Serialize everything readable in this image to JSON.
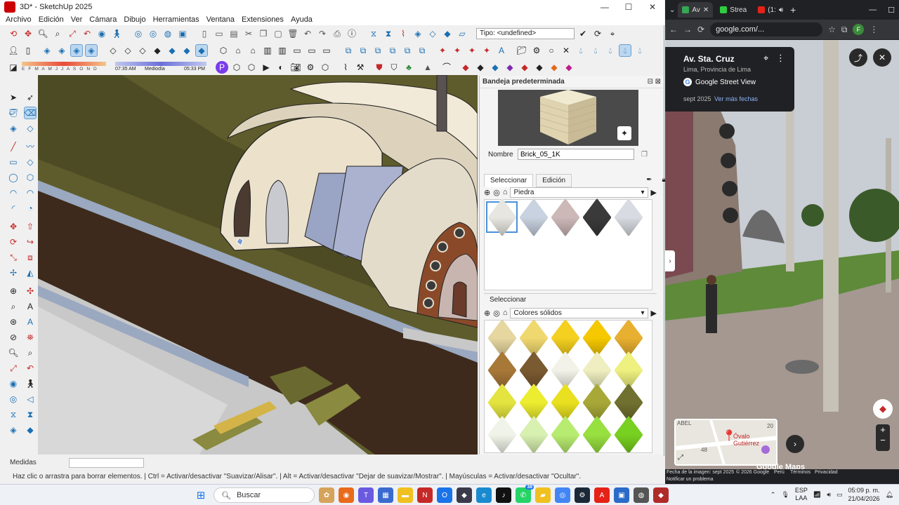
{
  "sketchup": {
    "title": "3D* - SketchUp 2025",
    "menu": [
      "Archivo",
      "Edición",
      "Ver",
      "Cámara",
      "Dibujo",
      "Herramientas",
      "Ventana",
      "Extensiones",
      "Ayuda"
    ],
    "tipo_field": "Tipo: <undefined>",
    "shadow_months": "E F M A M J J A S O N D",
    "time_start": "07:35 AM",
    "time_mid": "Mediodía",
    "time_end": "05:33 PM",
    "tray_title": "Bandeja predeterminada",
    "nombre_label": "Nombre",
    "material_name": "Brick_05_1K",
    "tab_select": "Seleccionar",
    "tab_edit": "Edición",
    "collection1": "Piedra",
    "select2_label": "Seleccionar",
    "collection2": "Colores sólidos",
    "medidas_label": "Medidas",
    "status_hint": "Haz clic o arrastra para borrar elementos. | Ctrl = Activar/desactivar \"Suavizar/Alisar\". | Alt = Activar/desactivar \"Dejar de suavizar/Mostrar\". | Mayúsculas = Activar/desactivar \"Ocultar\".",
    "stone_colors": [
      "#e8e6e0",
      "#c8d2e0",
      "#cdb8b8",
      "#3a3a3a",
      "#d8dce2"
    ],
    "solid_colors": [
      "#e6d6a0",
      "#f0d870",
      "#f4d020",
      "#f5c800",
      "#e8b030",
      "#a87838",
      "#7a5a30",
      "#f2f2e8",
      "#eeeec0",
      "#eef080",
      "#e4e440",
      "#ecec30",
      "#e8e020",
      "#a8a838",
      "#707030",
      "#f0f4e8",
      "#d8f0b0",
      "#b8ec70",
      "#98e040",
      "#78d020"
    ]
  },
  "chrome": {
    "tabs": [
      {
        "label": "Av",
        "color": "#34a853"
      },
      {
        "label": "Strea",
        "color": "#2ecc40"
      },
      {
        "label": "(1:",
        "color": "#e62117"
      }
    ],
    "url": "google.com/...",
    "place": "Av. Sta. Cruz",
    "region": "Lima, Provincia de Lima",
    "product": "Google Street View",
    "date": "sept 2025",
    "more_dates": "Ver más fechas",
    "map_label": "Óvalo Gutiérrez",
    "map_num1": "20",
    "map_num2": "48",
    "map_abbr": "ABEL",
    "watermark": "Google Maps",
    "footer_date": "Fecha de la imagen: sept 2025",
    "copyright": "© 2026 Google",
    "peru": "Perú",
    "terms": "Términos",
    "privacy": "Privacidad",
    "report": "Notificar un problema"
  },
  "taskbar": {
    "search": "Buscar",
    "lang": "ESP",
    "lang2": "LAA",
    "time": "05:09 p. m.",
    "date": "21/04/2026",
    "badge": "38"
  }
}
